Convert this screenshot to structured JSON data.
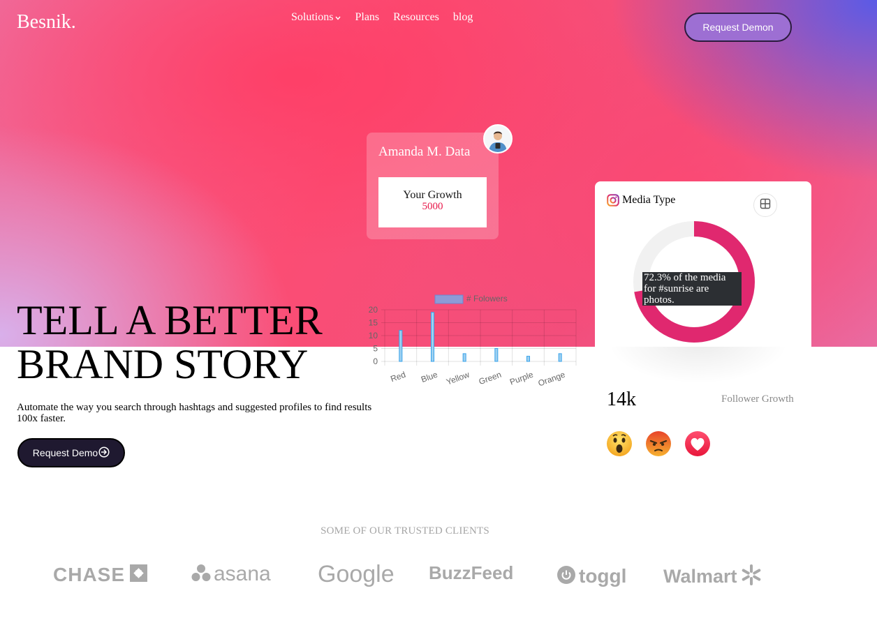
{
  "brand": {
    "logo": "Besnik."
  },
  "nav": {
    "items": [
      {
        "label": "Solutions",
        "has_dropdown": true
      },
      {
        "label": "Plans"
      },
      {
        "label": "Resources"
      },
      {
        "label": "blog"
      }
    ],
    "cta": "Request Demon"
  },
  "profile_card": {
    "name": "Amanda M. Data",
    "growth_label": "Your Growth",
    "growth_value": "5000"
  },
  "media_card": {
    "title": "Media Type",
    "tooltip": "72.3% of the media for #sunrise are photos.",
    "donut_percent": 72.3,
    "donut_color": "#e0286f",
    "stat_value": "14k",
    "stat_label": "Follower Growth",
    "reactions": [
      "wow-emoji",
      "angry-emoji",
      "love-emoji"
    ]
  },
  "hero": {
    "headline_line1": "TELL A BETTER",
    "headline_line2": "BRAND STORY",
    "subtext": "Automate the way you search through hashtags and suggested profiles to find results 100x faster.",
    "cta": "Request Demo"
  },
  "clients": {
    "title": "SOME OF OUR TRUSTED CLIENTS",
    "logos": [
      "CHASE",
      "asana",
      "Google",
      "BuzzFeed",
      "toggl",
      "Walmart"
    ]
  },
  "chart_data": {
    "type": "bar",
    "categories": [
      "Red",
      "Blue",
      "Yellow",
      "Green",
      "Purple",
      "Orange"
    ],
    "series": [
      {
        "name": "# Folowers",
        "values": [
          12,
          19,
          3,
          5,
          2,
          3
        ]
      }
    ],
    "ylim": [
      0,
      20
    ],
    "yticks": [
      0,
      5,
      10,
      15,
      20
    ],
    "legend": "top",
    "grid": true,
    "bar_fill": "#9ed0f0",
    "bar_stroke": "#36a2eb"
  }
}
